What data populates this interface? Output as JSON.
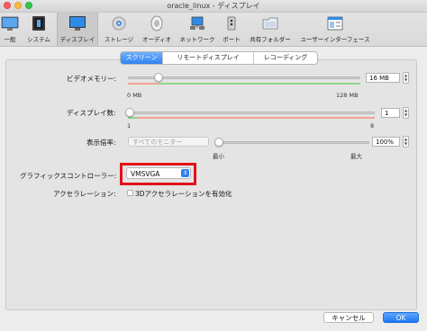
{
  "window": {
    "title": "oracle_linux - ディスプレイ"
  },
  "toolbar": {
    "items": [
      {
        "label": "一般",
        "icon": "monitor-general-icon"
      },
      {
        "label": "システム",
        "icon": "chip-icon"
      },
      {
        "label": "ディスプレイ",
        "icon": "display-icon",
        "active": true
      },
      {
        "label": "ストレージ",
        "icon": "storage-icon"
      },
      {
        "label": "オーディオ",
        "icon": "speaker-icon"
      },
      {
        "label": "ネットワーク",
        "icon": "network-icon"
      },
      {
        "label": "ポート",
        "icon": "port-icon"
      },
      {
        "label": "共有フォルダー",
        "icon": "folder-icon"
      },
      {
        "label": "ユーザーインターフェース",
        "icon": "ui-window-icon"
      }
    ]
  },
  "tabs": [
    {
      "label": "スクリーン",
      "active": true
    },
    {
      "label": "リモートディスプレイ"
    },
    {
      "label": "レコーディング"
    }
  ],
  "video_memory": {
    "label": "ビデオメモリー:",
    "value": "16 MB",
    "min": "0 MB",
    "max": "128 MB",
    "level_fraction": 0.125
  },
  "monitor_count": {
    "label": "ディスプレイ数:",
    "value": "1",
    "min": "1",
    "max": "8",
    "level_fraction": 0.0
  },
  "scale": {
    "label": "表示倍率:",
    "monitor_select": "すべてのモニター",
    "value": "100%",
    "min": "最小",
    "max": "最大",
    "level_fraction": 0.0
  },
  "graphics_controller": {
    "label": "グラフィックスコントローラー:",
    "value": "VMSVGA"
  },
  "acceleration": {
    "label": "アクセラレーション:",
    "checkbox_label": "3Dアクセラレーションを有効化",
    "checked": false
  },
  "buttons": {
    "cancel": "キャンセル",
    "ok": "OK"
  },
  "colors": {
    "accent": "#2f83f3",
    "highlight_box": "#e2121a",
    "bar_green": "#8fd68a",
    "bar_red": "#f2a394"
  }
}
